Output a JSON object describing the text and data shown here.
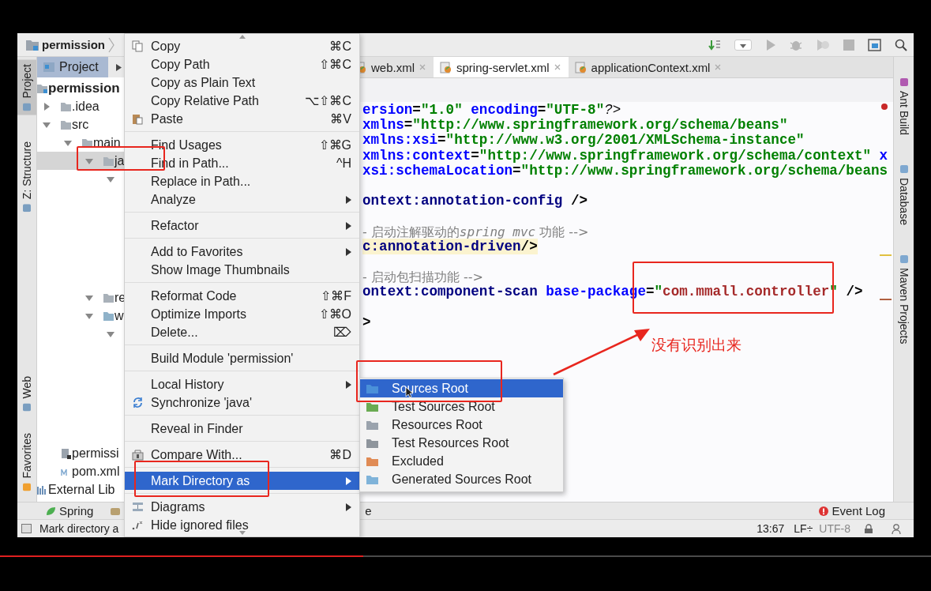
{
  "breadcrumb": {
    "label": "permission"
  },
  "left_tool_windows": [
    {
      "label": "Project",
      "selected": true
    },
    {
      "label": "Z: Structure",
      "selected": false
    },
    {
      "label": "Web",
      "selected": false
    },
    {
      "label": "Favorites",
      "selected": false
    }
  ],
  "project_panel": {
    "title": "Project",
    "tree": [
      {
        "name": "permission",
        "kind": "module",
        "children": [
          {
            "name": ".idea",
            "kind": "folder",
            "expanded": false
          },
          {
            "name": "src",
            "kind": "folder",
            "expanded": true,
            "children": [
              {
                "name": "main",
                "kind": "folder",
                "expanded": true,
                "children": [
                  {
                    "name": "ja",
                    "kind": "folder",
                    "expanded": true,
                    "selected": true,
                    "children": [
                      {
                        "expanded": true
                      }
                    ]
                  },
                  {
                    "name": "re",
                    "kind": "resources",
                    "expanded": true,
                    "selected": false
                  },
                  {
                    "name": "w",
                    "kind": "web",
                    "expanded": true,
                    "selected": false,
                    "children": [
                      {
                        "expanded": true
                      }
                    ]
                  }
                ]
              }
            ]
          },
          {
            "name": "permissi",
            "kind": "module_file"
          },
          {
            "name": "pom.xml",
            "kind": "maven_file"
          }
        ]
      },
      {
        "name": "External Lib",
        "kind": "library"
      }
    ]
  },
  "editor": {
    "tabs": [
      {
        "label": "web.xml",
        "selected": false
      },
      {
        "label": "spring-servlet.xml",
        "selected": true
      },
      {
        "label": "applicationContext.xml",
        "selected": false
      }
    ],
    "lines": [
      {
        "kind": "code",
        "highlighted": false,
        "segments": [
          {
            "kind": "attr",
            "text": "ersion"
          },
          {
            "kind": "plain",
            "text": "="
          },
          {
            "kind": "value",
            "text": "\"1.0\""
          },
          {
            "kind": "attr",
            "text": " encoding"
          },
          {
            "kind": "plain",
            "text": "="
          },
          {
            "kind": "value",
            "text": "\"UTF-8\""
          },
          {
            "kind": "italic",
            "text": "?>"
          }
        ]
      },
      {
        "kind": "code",
        "highlighted": false,
        "segments": [
          {
            "kind": "attr",
            "text": "xmlns"
          },
          {
            "kind": "plain",
            "text": "="
          },
          {
            "kind": "value",
            "text": "\"http://www.springframework.org/schema/beans\""
          }
        ]
      },
      {
        "kind": "code",
        "highlighted": false,
        "segments": [
          {
            "kind": "attr",
            "text": "xmlns:xsi"
          },
          {
            "kind": "plain",
            "text": "="
          },
          {
            "kind": "value",
            "text": "\"http://www.w3.org/2001/XMLSchema-instance\""
          }
        ]
      },
      {
        "kind": "code",
        "highlighted": false,
        "segments": [
          {
            "kind": "attr",
            "text": "xmlns:context"
          },
          {
            "kind": "plain",
            "text": "="
          },
          {
            "kind": "value",
            "text": "\"http://www.springframework.org/schema/context\""
          },
          {
            "kind": "attr",
            "text": " x"
          }
        ]
      },
      {
        "kind": "code",
        "highlighted": false,
        "segments": [
          {
            "kind": "attr",
            "text": "xsi:schemaLocation"
          },
          {
            "kind": "plain",
            "text": "="
          },
          {
            "kind": "value",
            "text": "\"http://www.springframework.org/schema/beans"
          }
        ]
      },
      {
        "kind": "blank"
      },
      {
        "kind": "code",
        "highlighted": false,
        "segments": [
          {
            "kind": "tag",
            "text": "ontext:annotation-config"
          },
          {
            "kind": "plain",
            "text": " />"
          }
        ]
      },
      {
        "kind": "blank"
      },
      {
        "kind": "code",
        "highlighted": false,
        "segments": [
          {
            "kind": "comment",
            "text": "- 启动注解驱动的"
          },
          {
            "kind": "comment_italic",
            "text": "spring mvc"
          },
          {
            "kind": "comment",
            "text": " 功能 -->"
          }
        ]
      },
      {
        "kind": "code",
        "highlighted": true,
        "segments": [
          {
            "kind": "tag",
            "text": "c:annotation-driven"
          },
          {
            "kind": "plain",
            "text": "/>"
          }
        ]
      },
      {
        "kind": "blank"
      },
      {
        "kind": "code",
        "highlighted": false,
        "segments": [
          {
            "kind": "comment",
            "text": "- 启动包扫描功能 -->"
          }
        ]
      },
      {
        "kind": "code",
        "highlighted": false,
        "segments": [
          {
            "kind": "tag",
            "text": "ontext:component-scan"
          },
          {
            "kind": "attr",
            "text": " base-package"
          },
          {
            "kind": "plain",
            "text": "="
          },
          {
            "kind": "value",
            "text": "\""
          },
          {
            "kind": "unresolved",
            "text": "com.mmall.controller"
          },
          {
            "kind": "value",
            "text": "\""
          },
          {
            "kind": "plain",
            "text": " />"
          }
        ]
      },
      {
        "kind": "blank"
      },
      {
        "kind": "code",
        "highlighted": false,
        "segments": [
          {
            "kind": "plain",
            "text": ">"
          }
        ]
      }
    ]
  },
  "right_tool_windows": [
    {
      "label": "Ant Build"
    },
    {
      "label": "Database"
    },
    {
      "label": "Maven Projects"
    }
  ],
  "bottom_tool_windows": [
    {
      "label": "Spring"
    },
    {
      "label": "e"
    },
    {
      "label": "Event Log"
    }
  ],
  "status_bar": {
    "message": "Mark directory a",
    "position": "13:67",
    "line_separator": "LF÷",
    "encoding": "UTF-8"
  },
  "context_menu": {
    "items": [
      {
        "kind": "item",
        "label": "Copy",
        "shortcut": "⌘C",
        "submenu": false,
        "selected": false
      },
      {
        "kind": "item",
        "label": "Copy Path",
        "shortcut": "⇧⌘C",
        "submenu": false,
        "selected": false
      },
      {
        "kind": "item",
        "label": "Copy as Plain Text",
        "submenu": false,
        "selected": false
      },
      {
        "kind": "item",
        "label": "Copy Relative Path",
        "shortcut": "⌥⇧⌘C",
        "submenu": false,
        "selected": false
      },
      {
        "kind": "item",
        "label": "Paste",
        "shortcut": "⌘V",
        "submenu": false,
        "selected": false
      },
      {
        "kind": "separator"
      },
      {
        "kind": "item",
        "label": "Find Usages",
        "shortcut": "⇧⌘G",
        "submenu": false,
        "selected": false
      },
      {
        "kind": "item",
        "label": "Find in Path...",
        "shortcut": "^H",
        "submenu": false,
        "selected": false
      },
      {
        "kind": "item",
        "label": "Replace in Path...",
        "submenu": false,
        "selected": false
      },
      {
        "kind": "item",
        "label": "Analyze",
        "submenu": true,
        "selected": false
      },
      {
        "kind": "separator"
      },
      {
        "kind": "item",
        "label": "Refactor",
        "submenu": true,
        "selected": false
      },
      {
        "kind": "separator"
      },
      {
        "kind": "item",
        "label": "Add to Favorites",
        "submenu": true,
        "selected": false
      },
      {
        "kind": "item",
        "label": "Show Image Thumbnails",
        "submenu": false,
        "selected": false
      },
      {
        "kind": "separator"
      },
      {
        "kind": "item",
        "label": "Reformat Code",
        "shortcut": "⇧⌘F",
        "submenu": false,
        "selected": false
      },
      {
        "kind": "item",
        "label": "Optimize Imports",
        "shortcut": "⇧⌘O",
        "submenu": false,
        "selected": false
      },
      {
        "kind": "item",
        "label": "Delete...",
        "shortcut": "⌦",
        "submenu": false,
        "selected": false
      },
      {
        "kind": "separator"
      },
      {
        "kind": "item",
        "label": "Build Module 'permission'",
        "submenu": false,
        "selected": false
      },
      {
        "kind": "separator"
      },
      {
        "kind": "item",
        "label": "Local History",
        "submenu": true,
        "selected": false
      },
      {
        "kind": "item",
        "label": "Synchronize 'java'",
        "submenu": false,
        "selected": false
      },
      {
        "kind": "separator"
      },
      {
        "kind": "item",
        "label": "Reveal in Finder",
        "submenu": false,
        "selected": false
      },
      {
        "kind": "separator"
      },
      {
        "kind": "item",
        "label": "Compare With...",
        "shortcut": "⌘D",
        "submenu": false,
        "selected": false
      },
      {
        "kind": "separator"
      },
      {
        "kind": "item",
        "label": "Mark Directory as",
        "submenu": true,
        "selected": true
      },
      {
        "kind": "separator"
      },
      {
        "kind": "item",
        "label": "Diagrams",
        "submenu": true,
        "selected": false
      },
      {
        "kind": "item",
        "label": "Hide ignored files",
        "submenu": false,
        "selected": false
      }
    ]
  },
  "submenu": {
    "items": [
      {
        "label": "Sources Root",
        "color": "#4a90d9",
        "selected": true
      },
      {
        "label": "Test Sources Root",
        "color": "#6aab52",
        "selected": false
      },
      {
        "label": "Resources Root",
        "color": "#9aa3ad",
        "selected": false
      },
      {
        "label": "Test Resources Root",
        "color": "#8e959c",
        "selected": false
      },
      {
        "label": "Excluded",
        "color": "#e08b55",
        "selected": false
      },
      {
        "label": "Generated Sources Root",
        "color": "#7fb3d9",
        "selected": false
      }
    ]
  },
  "annotation": {
    "text": "没有识别出来"
  },
  "video_progress": {
    "level": 0.39
  }
}
